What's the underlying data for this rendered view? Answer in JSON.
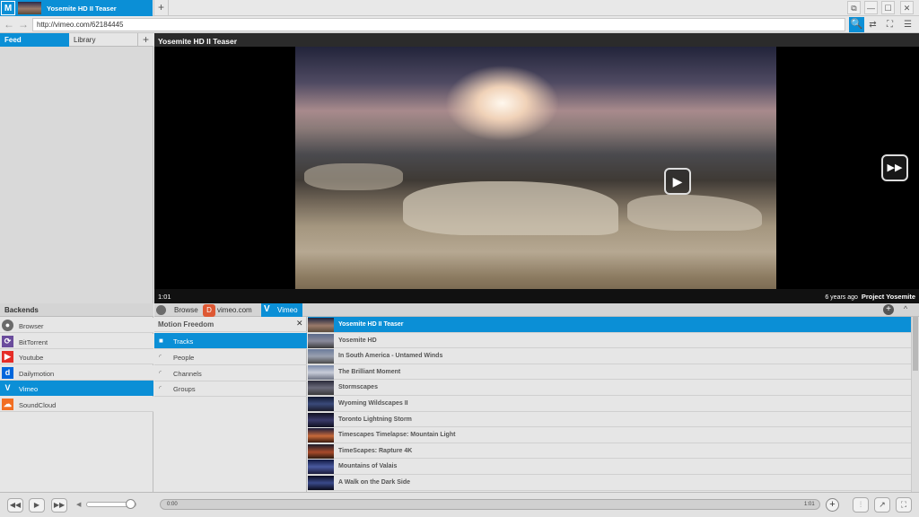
{
  "app": {
    "logo": "M"
  },
  "tabs": [
    {
      "label": "Yosemite HD II Teaser",
      "active": true
    }
  ],
  "newtab_icon": "+",
  "window_controls": {
    "restore": "⧉",
    "minimize": "—",
    "maximize": "☐",
    "close": "✕"
  },
  "address": {
    "back": "←",
    "forward": "→",
    "url": "http://vimeo.com/62184445",
    "search_icon": "🔍",
    "swap_icon": "⇄",
    "fullscreen_icon": "⛶",
    "list_icon": "☰"
  },
  "leftpane": {
    "tabs": [
      {
        "label": "Feed",
        "active": true
      },
      {
        "label": "Library",
        "active": false
      }
    ],
    "add": "+"
  },
  "video": {
    "title": "Yosemite HD II Teaser",
    "time": "1:01",
    "age": "6 years ago",
    "author": "Project Yosemite",
    "play_icon": "▶",
    "next_icon": "▶▶"
  },
  "backends": {
    "header": "Backends",
    "items": [
      {
        "label": "Browser",
        "icon": "globe-icon",
        "color": "#6b6b6b",
        "glyph": "●",
        "selected": false
      },
      {
        "label": "BitTorrent",
        "icon": "bittorrent-icon",
        "color": "#6a4c9c",
        "glyph": "⟳",
        "selected": false
      },
      {
        "label": "Youtube",
        "icon": "youtube-icon",
        "color": "#e52d27",
        "glyph": "▶",
        "selected": false
      },
      {
        "label": "Dailymotion",
        "icon": "dailymotion-icon",
        "color": "#0066dc",
        "glyph": "d",
        "selected": false
      },
      {
        "label": "Vimeo",
        "icon": "vimeo-icon",
        "color": "#0b8fd6",
        "glyph": "V",
        "selected": true
      },
      {
        "label": "SoundCloud",
        "icon": "soundcloud-icon",
        "color": "#f26f23",
        "glyph": "☁",
        "selected": false
      }
    ]
  },
  "browse": {
    "label": "Browse",
    "site": "vimeo.com",
    "vimeo_tab": "Vimeo",
    "duck_glyph": "D",
    "vimeo_glyph": "V",
    "add": "+",
    "collapse": "^"
  },
  "categories": {
    "header": "Motion Freedom",
    "close": "✕",
    "items": [
      {
        "label": "Tracks",
        "icon": "video-camera-icon",
        "glyph": "■",
        "selected": true
      },
      {
        "label": "People",
        "icon": "rss-icon",
        "glyph": "◜",
        "selected": false
      },
      {
        "label": "Channels",
        "icon": "rss-icon",
        "glyph": "◜",
        "selected": false
      },
      {
        "label": "Groups",
        "icon": "rss-icon",
        "glyph": "◜",
        "selected": false
      }
    ]
  },
  "tracks": [
    {
      "title": "Yosemite HD II Teaser",
      "selected": true
    },
    {
      "title": "Yosemite HD",
      "selected": false
    },
    {
      "title": "In South America - Untamed Winds",
      "selected": false
    },
    {
      "title": "The Brilliant Moment",
      "selected": false
    },
    {
      "title": "Stormscapes",
      "selected": false
    },
    {
      "title": "Wyoming Wildscapes II",
      "selected": false
    },
    {
      "title": "Toronto Lightning Storm",
      "selected": false
    },
    {
      "title": "Timescapes Timelapse: Mountain Light",
      "selected": false
    },
    {
      "title": "TimeScapes: Rapture 4K",
      "selected": false
    },
    {
      "title": "Mountains of Valais",
      "selected": false
    },
    {
      "title": "A Walk on the Dark Side",
      "selected": false
    }
  ],
  "player": {
    "prev": "◀◀",
    "play": "▶",
    "next": "▶▶",
    "vol_icon": "◀",
    "volume": 0.9,
    "seek_start": "0:00",
    "seek_end": "1:01",
    "add": "+",
    "eq_icon": "⫶",
    "share_icon": "↗",
    "fullscreen_icon": "⛶"
  },
  "colors": {
    "accent": "#0b8fd6"
  }
}
